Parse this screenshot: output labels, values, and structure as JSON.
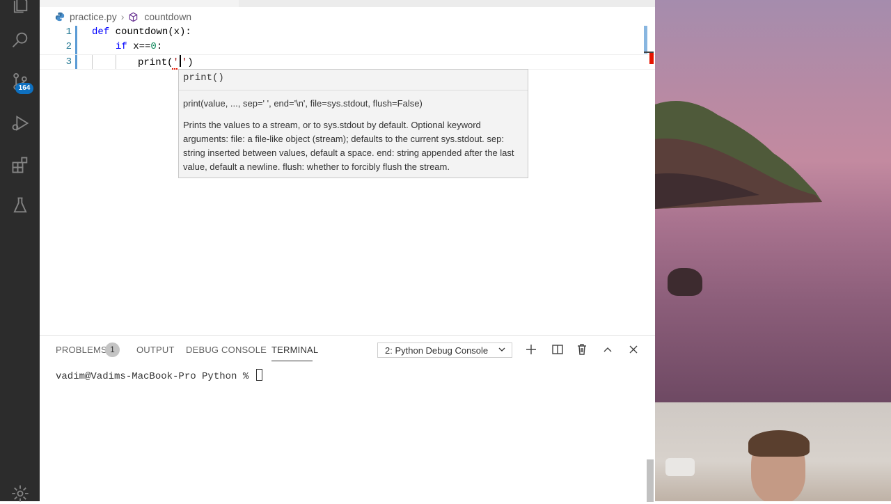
{
  "activity_bar": {
    "scm_badge": "164",
    "icons": [
      "files-icon",
      "search-icon",
      "source-control-icon",
      "run-debug-icon",
      "extensions-icon",
      "testing-icon",
      "settings-gear-icon"
    ]
  },
  "breadcrumb": {
    "file": "practice.py",
    "symbol": "countdown"
  },
  "editor": {
    "lines": [
      {
        "num": "1",
        "kw": "def",
        "text": " countdown(x):"
      },
      {
        "num": "2",
        "kw": "if",
        "pre": " x==",
        "numval": "0",
        "post": ":"
      },
      {
        "num": "3",
        "fn": "print(",
        "str_open": "'",
        "str_close": "'",
        "close": ")"
      }
    ]
  },
  "hover": {
    "signature": "print()",
    "full_signature": "print(value, ..., sep=' ', end='\\n', file=sys.stdout, flush=False)",
    "doc": "Prints the values to a stream, or to sys.stdout by default. Optional keyword arguments: file: a file-like object (stream); defaults to the current sys.stdout. sep: string inserted between values, default a space. end: string appended after the last value, default a newline. flush: whether to forcibly flush the stream."
  },
  "panel": {
    "tabs": {
      "problems": "PROBLEMS",
      "problems_count": "1",
      "output": "OUTPUT",
      "debug_console": "DEBUG CONSOLE",
      "terminal": "TERMINAL"
    },
    "terminal_select": "2: Python Debug Console",
    "terminal_prompt": "vadim@Vadims-MacBook-Pro Python % "
  },
  "colors": {
    "activity_bg": "#2c2c2c",
    "badge": "#0e70c0",
    "keyword": "#0000ff",
    "number": "#098658",
    "string": "#a31515",
    "line_number": "#237893"
  }
}
